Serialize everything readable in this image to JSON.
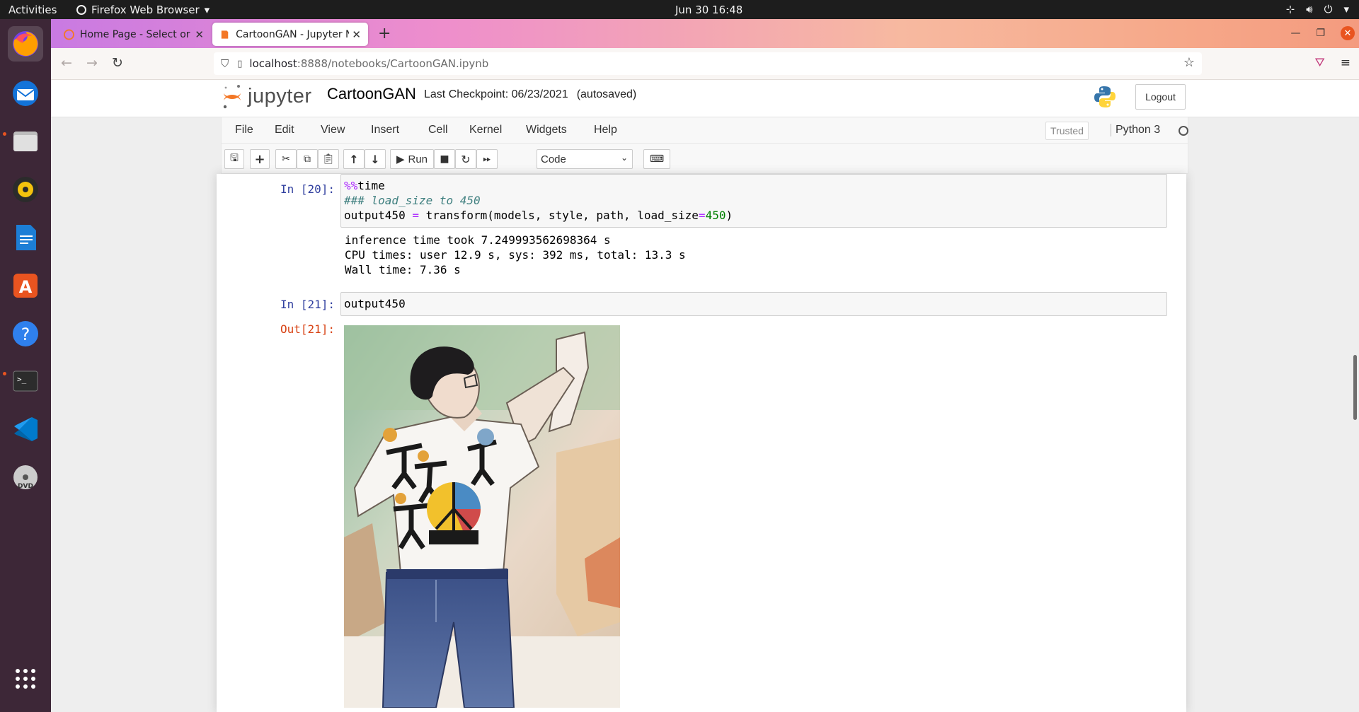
{
  "topbar": {
    "activities": "Activities",
    "app_name": "Firefox Web Browser",
    "clock": "Jun 30  16:48"
  },
  "browser": {
    "tabs": [
      {
        "label": "Home Page - Select or create",
        "active": false
      },
      {
        "label": "CartoonGAN - Jupyter Notebook",
        "active": true
      }
    ],
    "url_host": "localhost",
    "url_path": ":8888/notebooks/CartoonGAN.ipynb"
  },
  "jupyter": {
    "logo_text": "jupyter",
    "notebook_title": "CartoonGAN",
    "checkpoint": "Last Checkpoint: 06/23/2021",
    "autosave": "(autosaved)",
    "logout": "Logout",
    "menu": [
      "File",
      "Edit",
      "View",
      "Insert",
      "Cell",
      "Kernel",
      "Widgets",
      "Help"
    ],
    "trusted": "Trusted",
    "kernel": "Python 3",
    "run_label": "Run",
    "cell_type": "Code"
  },
  "cells": {
    "c20": {
      "prompt": "In [20]:",
      "line1_magic": "%%",
      "line1_rest": "time",
      "line2_comment": "### load_size to 450",
      "line3_a": "output450 ",
      "line3_eq": "=",
      "line3_b": " transform(models, style, path, load_size",
      "line3_eq2": "=",
      "line3_num": "450",
      "line3_c": ")",
      "output_lines": "inference time took 7.249993562698364 s\nCPU times: user 12.9 s, sys: 392 ms, total: 13.3 s\nWall time: 7.36 s"
    },
    "c21": {
      "prompt": "In [21]:",
      "code": "output450",
      "out_prompt": "Out[21]:"
    }
  },
  "colors": {
    "in_prompt": "#303f9f",
    "out_prompt": "#d84315",
    "ubuntu_orange": "#e95420"
  }
}
